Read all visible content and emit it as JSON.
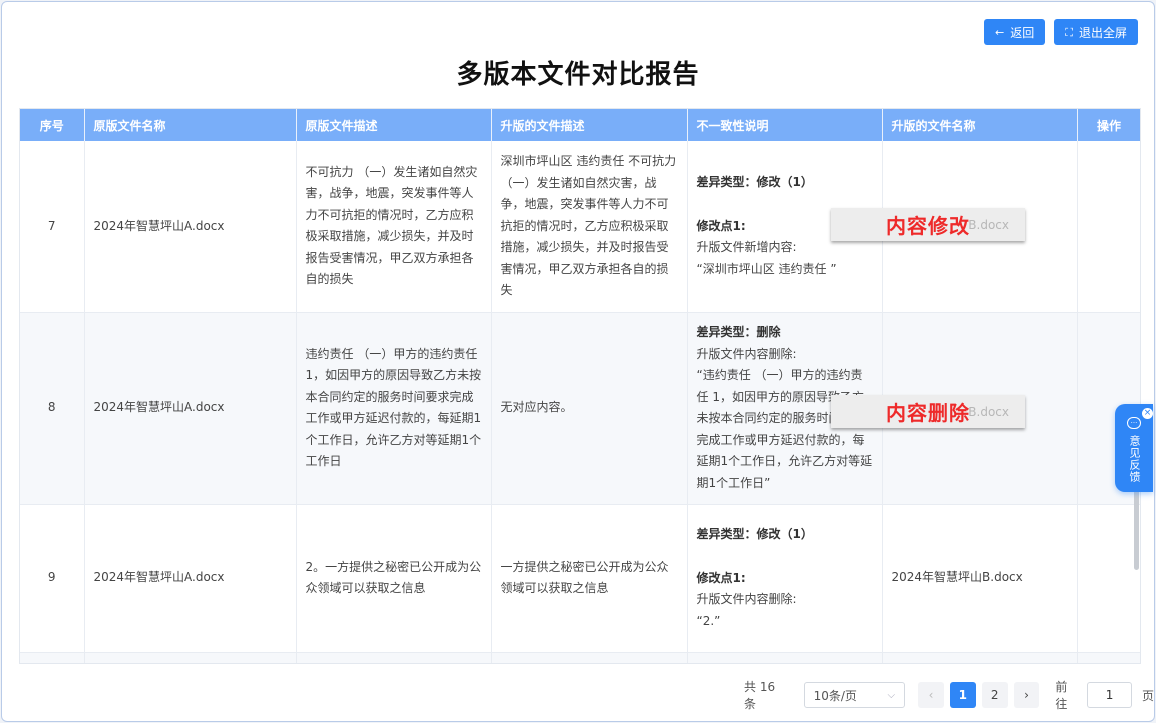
{
  "toolbar": {
    "back_label": "返回",
    "back_icon": "arrow-left-icon",
    "exit_fullscreen_label": "退出全屏",
    "exit_fullscreen_icon": "fullscreen-exit-icon"
  },
  "page": {
    "title": "多版本文件对比报告"
  },
  "table": {
    "headers": {
      "index": "序号",
      "orig_name": "原版文件名称",
      "orig_desc": "原版文件描述",
      "upg_desc": "升版的文件描述",
      "diff": "不一致性说明",
      "upg_name": "升版的文件名称",
      "op": "操作"
    },
    "rows": [
      {
        "index": "7",
        "orig_name": "2024年智慧坪山A.docx",
        "orig_desc": "不可抗力 （一）发生诸如自然灾害，战争，地震，突发事件等人力不可抗拒的情况时，乙方应积极采取措施，减少损失，并及时报告受害情况，甲乙双方承担各自的损失",
        "upg_desc": "深圳市坪山区 违约责任 不可抗力 （一）发生诸如自然灾害，战争，地震，突发事件等人力不可抗拒的情况时，乙方应积极采取措施，减少损失，并及时报告受害情况，甲乙双方承担各自的损失",
        "diff_type": "差异类型：修改（1）",
        "diff_point": "修改点1:",
        "diff_line1": "升版文件新增内容:",
        "diff_line2": "“深圳市坪山区 违约责任 ”",
        "upg_name_ghost": "B.docx",
        "overlay": "内容修改"
      },
      {
        "index": "8",
        "orig_name": "2024年智慧坪山A.docx",
        "orig_desc": "违约责任 （一）甲方的违约责任 1，如因甲方的原因导致乙方未按本合同约定的服务时间要求完成工作或甲方延迟付款的，每延期1个工作日，允许乙方对等延期1个工作日",
        "upg_desc": "无对应内容。",
        "diff_type": "差异类型：删除",
        "diff_line1": "升版文件内容删除:",
        "diff_line2": "“违约责任 （一）甲方的违约责任 1，如因甲方的原因导致乙方未按本合同约定的服务时间要求完成工作或甲方延迟付款的，每延期1个工作日，允许乙方对等延期1个工作日”",
        "upg_name_ghost": "B.docx",
        "overlay": "内容删除"
      },
      {
        "index": "9",
        "orig_name": "2024年智慧坪山A.docx",
        "orig_desc": "2。一方提供之秘密已公开成为公众领域可以获取之信息",
        "upg_desc": "一方提供之秘密已公开成为公众领域可以获取之信息",
        "diff_type": "差异类型：修改（1）",
        "diff_point": "修改点1:",
        "diff_line1": "升版文件内容删除:",
        "diff_line2": "“2.”",
        "upg_name": "2024年智慧坪山B.docx"
      }
    ]
  },
  "pagination": {
    "total": "共 16 条",
    "page_size": "10条/页",
    "prev_icon": "chevron-left-icon",
    "next_icon": "chevron-right-icon",
    "pages": [
      "1",
      "2"
    ],
    "current": "1",
    "goto_label": "前往",
    "goto_value": "1",
    "page_suffix": "页"
  },
  "feedback": {
    "label": "意见反馈",
    "icon": "chat-bubble-icon",
    "close_icon": "close-icon"
  }
}
